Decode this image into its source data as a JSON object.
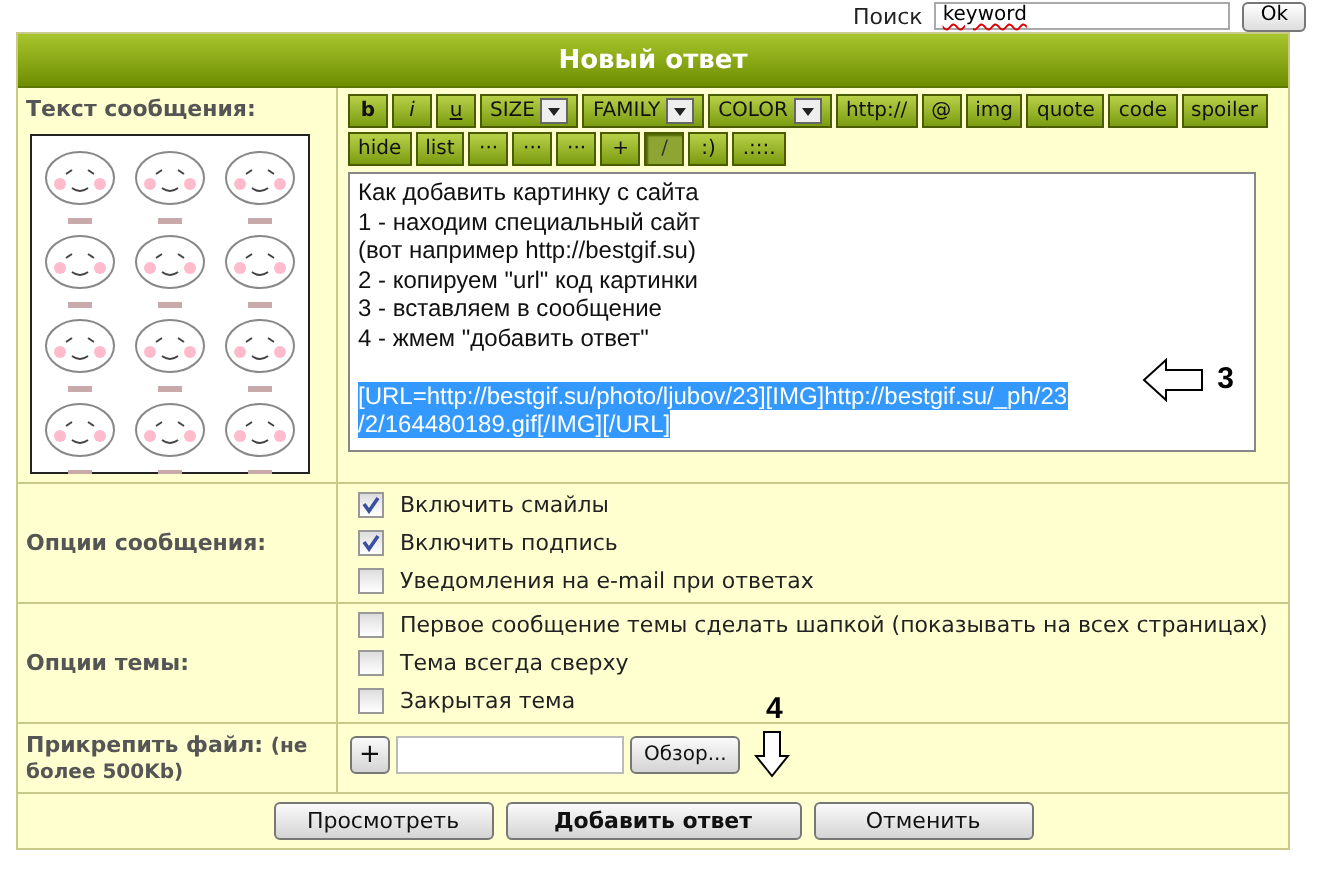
{
  "search": {
    "label": "Поиск",
    "value": "keyword",
    "button": "Ok"
  },
  "title": "Новый ответ",
  "message": {
    "label": "Текст сообщения:",
    "toolbar": [
      {
        "label": "b",
        "kind": "bold",
        "pressed": false
      },
      {
        "label": "i",
        "kind": "italic",
        "pressed": false
      },
      {
        "label": "u",
        "kind": "underline",
        "pressed": false
      },
      {
        "label": "SIZE",
        "kind": "dropdown",
        "pressed": false
      },
      {
        "label": "FAMILY",
        "kind": "dropdown",
        "pressed": false
      },
      {
        "label": "COLOR",
        "kind": "dropdown",
        "pressed": false
      },
      {
        "label": "http://",
        "kind": "button",
        "pressed": false
      },
      {
        "label": "@",
        "kind": "button",
        "pressed": false
      },
      {
        "label": "img",
        "kind": "button",
        "pressed": false
      },
      {
        "label": "quote",
        "kind": "button",
        "pressed": false
      },
      {
        "label": "code",
        "kind": "button",
        "pressed": false
      },
      {
        "label": "spoiler",
        "kind": "button",
        "pressed": false
      },
      {
        "label": "hide",
        "kind": "button",
        "pressed": false
      },
      {
        "label": "list",
        "kind": "button",
        "pressed": false
      },
      {
        "label": "···",
        "kind": "button",
        "pressed": false
      },
      {
        "label": "···",
        "kind": "button",
        "pressed": false
      },
      {
        "label": "···",
        "kind": "button",
        "pressed": false
      },
      {
        "label": "+",
        "kind": "button",
        "pressed": false
      },
      {
        "label": "/",
        "kind": "button",
        "pressed": true
      },
      {
        "label": ":)",
        "kind": "button",
        "pressed": false
      },
      {
        "label": ".:::.",
        "kind": "button",
        "pressed": false
      }
    ],
    "blocks": [
      {
        "selected": false,
        "lines": [
          "Как добавить картинку с сайта",
          "1 - находим специальный сайт",
          "(вот например http://bestgif.su)",
          "2 - копируем \"url\" код картинки",
          "3 - вставляем в сообщение",
          "4 - жмем \"добавить ответ\""
        ]
      },
      {
        "selected": true,
        "lines": [
          "[URL=http://bestgif.su/photo/ljubov/23][IMG]http://bestgif.su/_ph/23",
          "/2/164480189.gif[/IMG][/URL]"
        ]
      }
    ],
    "annotation": "3"
  },
  "message_options": {
    "label": "Опции сообщения:",
    "items": [
      {
        "label": "Включить смайлы",
        "checked": true
      },
      {
        "label": "Включить подпись",
        "checked": true
      },
      {
        "label": "Уведомления на e-mail при ответах",
        "checked": false
      }
    ]
  },
  "topic_options": {
    "label": "Опции темы:",
    "items": [
      {
        "label": "Первое сообщение темы сделать шапкой (показывать на всех страницах)",
        "checked": false
      },
      {
        "label": "Тема всегда сверху",
        "checked": false
      },
      {
        "label": "Закрытая тема",
        "checked": false
      }
    ]
  },
  "attach": {
    "label": "Прикрепить файл:",
    "note": "(не более 500Kb)",
    "add_button": "+",
    "browse_button": "Обзор...",
    "annotation": "4"
  },
  "buttons": [
    {
      "label": "Просмотреть",
      "primary": false
    },
    {
      "label": "Добавить ответ",
      "primary": true
    },
    {
      "label": "Отменить",
      "primary": false
    }
  ]
}
